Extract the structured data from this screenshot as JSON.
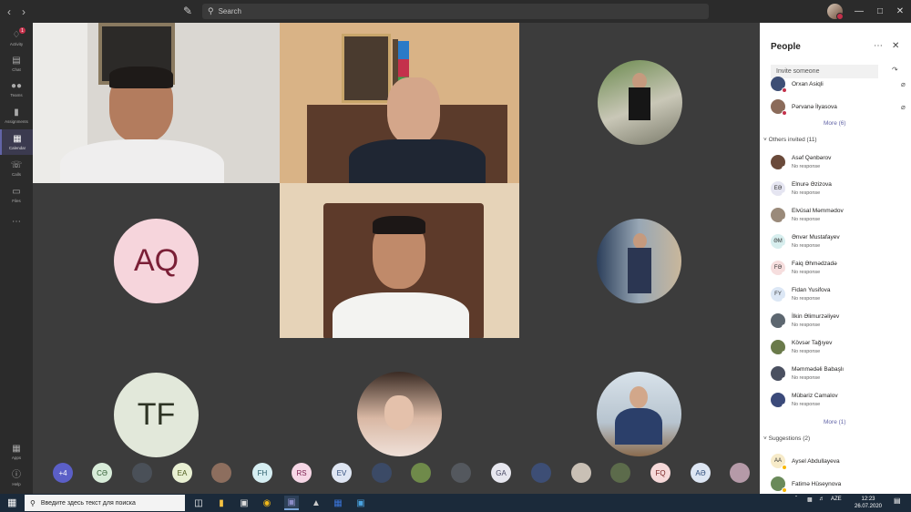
{
  "titlebar": {
    "search_placeholder": "Search"
  },
  "rail": {
    "items": [
      {
        "label": "Activity",
        "icon": "bell-icon",
        "badge": "1"
      },
      {
        "label": "Chat",
        "icon": "chat-icon"
      },
      {
        "label": "Teams",
        "icon": "teams-icon"
      },
      {
        "label": "Assignments",
        "icon": "assignments-icon"
      },
      {
        "label": "Calendar",
        "icon": "calendar-icon"
      },
      {
        "label": "Calls",
        "icon": "phone-icon"
      },
      {
        "label": "Files",
        "icon": "file-icon"
      },
      {
        "label": "Apps",
        "icon": "apps-icon"
      },
      {
        "label": "Help",
        "icon": "help-icon"
      }
    ]
  },
  "stage": {
    "avatars": [
      {
        "initials": "AQ",
        "bg": "#f6d5dc",
        "fg": "#7a1f36"
      },
      {
        "initials": "TF",
        "bg": "#e2e8da",
        "fg": "#2d3324"
      }
    ],
    "strip": [
      {
        "initials": "+4",
        "bg": "#5b5fc7",
        "fg": "#ffffff"
      },
      {
        "initials": "CƏ",
        "bg": "#d8ecd9",
        "fg": "#2c5a2f"
      },
      {
        "initials": "",
        "bg": "#4a5058"
      },
      {
        "initials": "EA",
        "bg": "#e9f0d3",
        "fg": "#4c5b1c"
      },
      {
        "initials": "",
        "bg": "#8d6e5e"
      },
      {
        "initials": "FH",
        "bg": "#d6eef2",
        "fg": "#255a66"
      },
      {
        "initials": "RS",
        "bg": "#f6d7e6",
        "fg": "#7c2150"
      },
      {
        "initials": "EV",
        "bg": "#dfe6f3",
        "fg": "#2f4c7a"
      },
      {
        "initials": "",
        "bg": "#3b4a66"
      },
      {
        "initials": "",
        "bg": "#6f8a4a"
      },
      {
        "initials": "",
        "bg": "#54585e"
      },
      {
        "initials": "GA",
        "bg": "#e7e7ef",
        "fg": "#4b4b66"
      },
      {
        "initials": "",
        "bg": "#3d4e75"
      },
      {
        "initials": "",
        "bg": "#c9c0b5"
      },
      {
        "initials": "",
        "bg": "#5c6b4b"
      },
      {
        "initials": "FQ",
        "bg": "#f6d9d9",
        "fg": "#7a2626"
      },
      {
        "initials": "AƏ",
        "bg": "#dde6f3",
        "fg": "#2b4a78"
      },
      {
        "initials": "",
        "bg": "#b59aa8"
      }
    ]
  },
  "panel": {
    "title": "People",
    "invite_placeholder": "Invite someone",
    "in_meeting": [
      {
        "name": "Orxan Asiqli",
        "bg": "#3d4e75",
        "status": "#c4314b"
      },
      {
        "name": "Pərvanə İlyasova",
        "bg": "#8b6b5a",
        "status": "#c4314b"
      }
    ],
    "more_1": "More (6)",
    "others_header": "Others invited (11)",
    "others": [
      {
        "name": "Asəf Qənbərov",
        "status": "No response",
        "initials": "",
        "bg": "#6a4a3a"
      },
      {
        "name": "Elnurə Əzizova",
        "status": "No response",
        "initials": "EƏ",
        "bg": "#e5e5f1"
      },
      {
        "name": "Elvüsal Məmmədov",
        "status": "No response",
        "initials": "",
        "bg": "#9a8a7a"
      },
      {
        "name": "Ənvər Mustafayev",
        "status": "No response",
        "initials": "ƏM",
        "bg": "#d7eeee"
      },
      {
        "name": "Faiq Əhmədzadə",
        "status": "No response",
        "initials": "FƏ",
        "bg": "#f6dede"
      },
      {
        "name": "Fidan Yusifova",
        "status": "No response",
        "initials": "FY",
        "bg": "#dce7f5"
      },
      {
        "name": "İlkin Əlimurzəliyev",
        "status": "No response",
        "initials": "",
        "bg": "#5d6770"
      },
      {
        "name": "Kövsər Tağıyev",
        "status": "No response",
        "initials": "",
        "bg": "#6a7a4a"
      },
      {
        "name": "Məmmədəli Babaşlı",
        "status": "No response",
        "initials": "",
        "bg": "#4a5060"
      },
      {
        "name": "Mübariz Camalov",
        "status": "No response",
        "initials": "",
        "bg": "#3b4a7a"
      }
    ],
    "more_2": "More (1)",
    "suggestions_header": "Suggestions (2)",
    "suggestions": [
      {
        "name": "Aysel Abdullayeva",
        "initials": "AA",
        "bg": "#f7ebc9",
        "status": "#f8b700"
      },
      {
        "name": "Fatimə Hüseynova",
        "initials": "",
        "bg": "#6a8a5a",
        "status": "#f8b700"
      }
    ]
  },
  "taskbar": {
    "search_placeholder": "Введите здесь текст для поиска",
    "lang": "AZE",
    "time": "12:23",
    "date": "26.07.2020"
  }
}
